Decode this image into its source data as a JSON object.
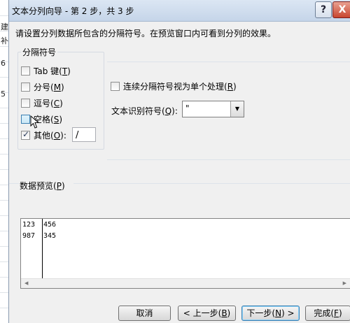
{
  "background": {
    "sheet_chars": [
      "建",
      "补",
      "6",
      "5"
    ]
  },
  "window": {
    "title": "文本分列向导 - 第 2 步，共 3 步",
    "help_glyph": "?",
    "close_glyph": "X"
  },
  "instruction": "请设置分列数据所包含的分隔符号。在预览窗口内可看到分列的效果。",
  "delimiters": {
    "title": "分隔符号",
    "items": [
      {
        "text": "Tab 键(",
        "key": "T",
        "tail": ")",
        "checked": false
      },
      {
        "text": "分号(",
        "key": "M",
        "tail": ")",
        "checked": false
      },
      {
        "text": "逗号(",
        "key": "C",
        "tail": ")",
        "checked": false
      },
      {
        "text": "空格(",
        "key": "S",
        "tail": ")",
        "checked": false
      },
      {
        "text": "其他(",
        "key": "O",
        "tail": "):",
        "checked": true
      }
    ],
    "other_value": "/"
  },
  "consecutive": {
    "text": "连续分隔符号视为单个处理(",
    "key": "R",
    "tail": ")",
    "checked": false
  },
  "qualifier": {
    "text": "文本识别符号(",
    "key": "Q",
    "tail": "):",
    "value": "\""
  },
  "preview": {
    "label_text": "数据预览(",
    "label_key": "P",
    "label_tail": ")",
    "rows": [
      [
        "123",
        "456"
      ],
      [
        "987",
        "345"
      ]
    ]
  },
  "buttons": {
    "cancel": "取消",
    "back": {
      "text": "< 上一步(",
      "key": "B",
      "tail": ")"
    },
    "next": {
      "text": "下一步(",
      "key": "N",
      "tail": ") >"
    },
    "finish": {
      "text": "完成(",
      "key": "F",
      "tail": ")"
    }
  },
  "colors": {
    "accent": "#3c7fb1",
    "close": "#c8452f"
  }
}
